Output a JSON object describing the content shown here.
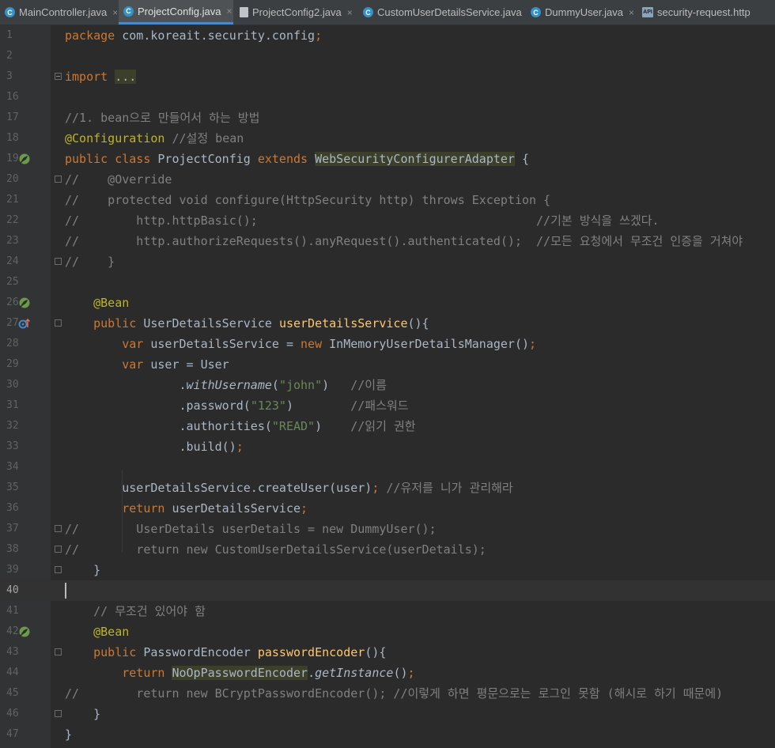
{
  "tabs": [
    {
      "label": "MainController.java",
      "icon": "class-icon",
      "active": false
    },
    {
      "label": "ProjectConfig.java",
      "icon": "class-icon",
      "active": true
    },
    {
      "label": "ProjectConfig2.java",
      "icon": "java-file-icon",
      "active": false
    },
    {
      "label": "CustomUserDetailsService.java",
      "icon": "class-icon",
      "active": false
    },
    {
      "label": "DummyUser.java",
      "icon": "class-icon",
      "active": false
    },
    {
      "label": "security-request.http",
      "icon": "api-file-icon",
      "active": false
    }
  ],
  "icons": {
    "close": "×",
    "class": "C",
    "api": "API"
  },
  "colors": {
    "keyword": "#cc7832",
    "comment": "#808080",
    "annotation": "#bbb529",
    "method": "#ffc66d",
    "string": "#6a8759",
    "text": "#a9b7c6",
    "background": "#2b2b2b"
  },
  "editor": {
    "caret_line": 40,
    "lines": [
      {
        "n": "1",
        "tokens": [
          [
            "kw",
            "package "
          ],
          [
            "",
            "com.koreait.security.config"
          ],
          [
            "kw",
            ";"
          ]
        ]
      },
      {
        "n": "2",
        "tokens": []
      },
      {
        "n": "3",
        "fold": "plus",
        "tokens": [
          [
            "kw",
            "import "
          ],
          [
            "hl",
            "..."
          ]
        ]
      },
      {
        "n": "16",
        "tokens": []
      },
      {
        "n": "17",
        "tokens": [
          [
            "cm",
            "//1. bean으로 만들어서 하는 방법"
          ]
        ]
      },
      {
        "n": "18",
        "tokens": [
          [
            "an",
            "@Configuration "
          ],
          [
            "cm",
            "//설정 bean"
          ]
        ]
      },
      {
        "n": "19",
        "gicon": "spring-bean-icon",
        "tokens": [
          [
            "kw",
            "public class "
          ],
          [
            "",
            "ProjectConfig "
          ],
          [
            "kw",
            "extends "
          ],
          [
            "hl",
            "WebSecurityConfigurerAdapter"
          ],
          [
            "",
            " {"
          ]
        ]
      },
      {
        "n": "20",
        "fold": "box",
        "tokens": [
          [
            "cm",
            "//    @Override"
          ]
        ]
      },
      {
        "n": "21",
        "tokens": [
          [
            "cm",
            "//    protected void configure(HttpSecurity http) throws Exception {"
          ]
        ]
      },
      {
        "n": "22",
        "tokens": [
          [
            "cm",
            "//        http.httpBasic();                                       //기본 방식을 쓰겠다."
          ]
        ]
      },
      {
        "n": "23",
        "tokens": [
          [
            "cm",
            "//        http.authorizeRequests().anyRequest().authenticated();  //모든 요청에서 무조건 인증을 거쳐야"
          ]
        ]
      },
      {
        "n": "24",
        "fold": "box",
        "tokens": [
          [
            "cm",
            "//    }"
          ]
        ]
      },
      {
        "n": "25",
        "tokens": []
      },
      {
        "n": "26",
        "gicon": "spring-bean-icon",
        "tokens": [
          [
            "",
            "    "
          ],
          [
            "an",
            "@Bean"
          ]
        ]
      },
      {
        "n": "27",
        "gicon": "override-icon",
        "fold": "box",
        "tokens": [
          [
            "",
            "    "
          ],
          [
            "kw",
            "public "
          ],
          [
            "",
            "UserDetailsService "
          ],
          [
            "fn",
            "userDetailsService"
          ],
          [
            "",
            "(){"
          ]
        ]
      },
      {
        "n": "28",
        "tokens": [
          [
            "",
            "        "
          ],
          [
            "kw",
            "var "
          ],
          [
            "",
            "userDetailsService = "
          ],
          [
            "kw",
            "new "
          ],
          [
            "",
            "InMemoryUserDetailsManager()"
          ],
          [
            "kw",
            ";"
          ]
        ]
      },
      {
        "n": "29",
        "tokens": [
          [
            "",
            "        "
          ],
          [
            "kw",
            "var "
          ],
          [
            "",
            "user = User"
          ]
        ]
      },
      {
        "n": "30",
        "tokens": [
          [
            "",
            "                ."
          ],
          [
            "it",
            "withUsername"
          ],
          [
            "",
            "("
          ],
          [
            "st",
            "\"john\""
          ],
          [
            "",
            ")   "
          ],
          [
            "cm",
            "//이름"
          ]
        ]
      },
      {
        "n": "31",
        "tokens": [
          [
            "",
            "                .password("
          ],
          [
            "st",
            "\"123\""
          ],
          [
            "",
            ")        "
          ],
          [
            "cm",
            "//패스워드"
          ]
        ]
      },
      {
        "n": "32",
        "tokens": [
          [
            "",
            "                .authorities("
          ],
          [
            "st",
            "\"READ\""
          ],
          [
            "",
            ")    "
          ],
          [
            "cm",
            "//읽기 권한"
          ]
        ]
      },
      {
        "n": "33",
        "tokens": [
          [
            "",
            "                .build()"
          ],
          [
            "kw",
            ";"
          ]
        ]
      },
      {
        "n": "34",
        "tokens": []
      },
      {
        "n": "35",
        "tokens": [
          [
            "",
            "        userDetailsService.createUser(user)"
          ],
          [
            "kw",
            "; "
          ],
          [
            "cm",
            "//유저를 니가 관리해라"
          ]
        ]
      },
      {
        "n": "36",
        "tokens": [
          [
            "",
            "        "
          ],
          [
            "kw",
            "return "
          ],
          [
            "",
            "userDetailsService"
          ],
          [
            "kw",
            ";"
          ]
        ]
      },
      {
        "n": "37",
        "fold": "box",
        "tokens": [
          [
            "cm",
            "//        UserDetails userDetails = new DummyUser();"
          ]
        ]
      },
      {
        "n": "38",
        "fold": "box",
        "tokens": [
          [
            "cm",
            "//        return new CustomUserDetailsService(userDetails);"
          ]
        ]
      },
      {
        "n": "39",
        "fold": "box",
        "tokens": [
          [
            "",
            "    }"
          ]
        ]
      },
      {
        "n": "40",
        "tokens": []
      },
      {
        "n": "41",
        "tokens": [
          [
            "",
            "    "
          ],
          [
            "cm",
            "// 무조건 있어야 함"
          ]
        ]
      },
      {
        "n": "42",
        "gicon": "spring-bean-icon",
        "tokens": [
          [
            "",
            "    "
          ],
          [
            "an",
            "@Bean"
          ]
        ]
      },
      {
        "n": "43",
        "fold": "box",
        "tokens": [
          [
            "",
            "    "
          ],
          [
            "kw",
            "public "
          ],
          [
            "",
            "PasswordEncoder "
          ],
          [
            "fn",
            "passwordEncoder"
          ],
          [
            "",
            "(){"
          ]
        ]
      },
      {
        "n": "44",
        "tokens": [
          [
            "",
            "        "
          ],
          [
            "kw",
            "return "
          ],
          [
            "hl",
            "NoOpPasswordEncoder"
          ],
          [
            "",
            "."
          ],
          [
            "it",
            "getInstance"
          ],
          [
            "",
            "()"
          ],
          [
            "kw",
            ";"
          ]
        ]
      },
      {
        "n": "45",
        "tokens": [
          [
            "cm",
            "//        return new BCryptPasswordEncoder(); //이렇게 하면 평문으로는 로그인 못함 (해시로 하기 때문에)"
          ]
        ]
      },
      {
        "n": "46",
        "fold": "box",
        "tokens": [
          [
            "",
            "    }"
          ]
        ]
      },
      {
        "n": "47",
        "tokens": [
          [
            "",
            "}"
          ]
        ]
      }
    ]
  }
}
